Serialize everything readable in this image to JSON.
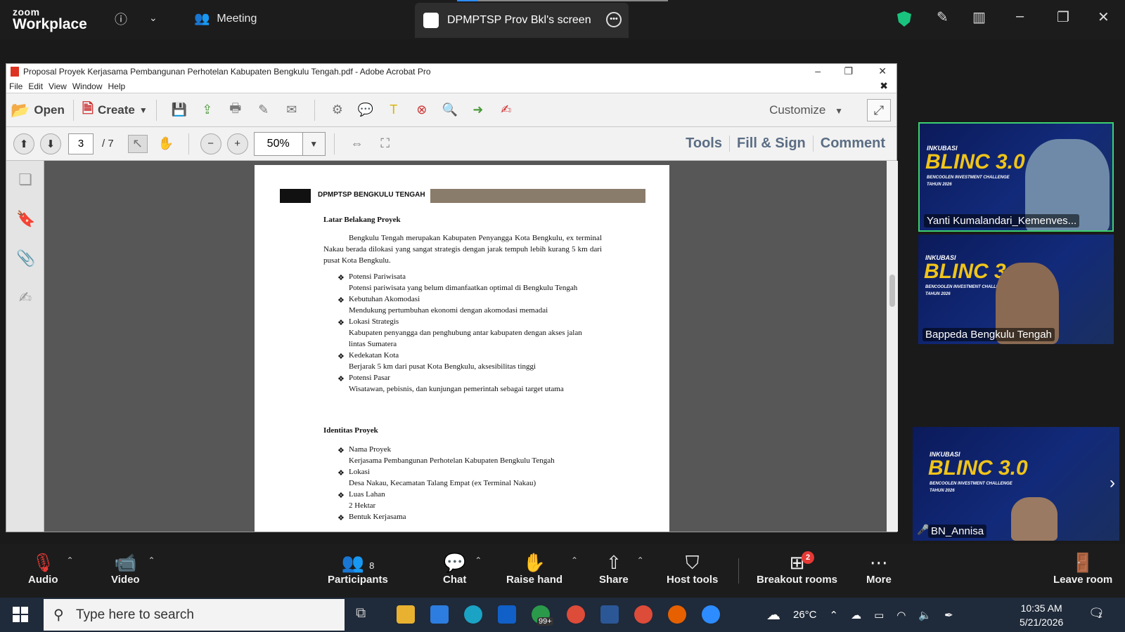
{
  "zoom": {
    "logo_line1": "zoom",
    "logo_line2": "Workplace",
    "meeting_tab": "Meeting",
    "screen_tab": "DPMPTSP Prov Bkl's screen",
    "colors": {
      "bar_bg": "#1c1c1c",
      "shield": "#19c37d",
      "active_border": "#3cd070"
    }
  },
  "acrobat": {
    "title": "Proposal Proyek Kerjasama Pembangunan Perhotelan Kabupaten Bengkulu Tengah.pdf - Adobe Acrobat Pro",
    "menu": [
      "File",
      "Edit",
      "View",
      "Window",
      "Help"
    ],
    "open_label": "Open",
    "create_label": "Create",
    "customize_label": "Customize",
    "page_current": "3",
    "page_total": "/ 7",
    "zoom_value": "50%",
    "right_tabs": [
      "Tools",
      "Fill & Sign",
      "Comment"
    ]
  },
  "pdf": {
    "header": "DPMPTSP BENGKULU TENGAH",
    "section1_title": "Latar Belakang Proyek",
    "section1_para": "Bengkulu Tengah merupakan Kabupaten Penyangga Kota Bengkulu, ex terminal Nakau berada dilokasi yang sangat strategis dengan jarak tempuh lebih kurang 5 km dari pusat Kota Bengkulu.",
    "bullets1": [
      {
        "title": "Potensi Pariwisata",
        "desc": "Potensi pariwisata yang belum dimanfaatkan optimal di Bengkulu Tengah"
      },
      {
        "title": "Kebutuhan Akomodasi",
        "desc": "Mendukung pertumbuhan ekonomi dengan akomodasi memadai"
      },
      {
        "title": "Lokasi Strategis",
        "desc": "Kabupaten penyangga dan penghubung antar kabupaten dengan akses jalan lintas Sumatera"
      },
      {
        "title": "Kedekatan Kota",
        "desc": "Berjarak 5 km dari pusat Kota Bengkulu, aksesibilitas tinggi"
      },
      {
        "title": "Potensi Pasar",
        "desc": "Wisatawan, pebisnis, dan kunjungan pemerintah sebagai target utama"
      }
    ],
    "section2_title": "Identitas Proyek",
    "bullets2": [
      {
        "title": "Nama Proyek",
        "desc": "Kerjasama Pembangunan Perhotelan Kabupaten Bengkulu Tengah"
      },
      {
        "title": "Lokasi",
        "desc": "Desa Nakau, Kecamatan Talang Empat (ex Terminal Nakau)"
      },
      {
        "title": "Luas Lahan",
        "desc": "2 Hektar"
      },
      {
        "title": "Bentuk Kerjasama",
        "desc": ""
      }
    ]
  },
  "participants": {
    "tile_brand_small": "INKUBASI",
    "tile_brand": "BLINC 3.0",
    "tile_sub": "BENCOOLEN INVESTMENT CHALLENGE",
    "tile_year": "TAHUN 2026",
    "names": [
      "Yanti Kumalandari_Kemenves...",
      "Bappeda Bengkulu Tengah",
      "BN_Annisa"
    ]
  },
  "bottom_bar": {
    "audio": "Audio",
    "video": "Video",
    "participants": "Participants",
    "participants_count": "8",
    "chat": "Chat",
    "raise_hand": "Raise hand",
    "share": "Share",
    "host_tools": "Host tools",
    "breakout_rooms": "Breakout rooms",
    "breakout_badge": "2",
    "more": "More",
    "leave_room": "Leave room"
  },
  "taskbar": {
    "search_placeholder": "Type here to search",
    "badge_99": "99+",
    "weather": "26°C",
    "time": "10:35 AM",
    "date": "5/21/2026",
    "notification_count": "1"
  }
}
